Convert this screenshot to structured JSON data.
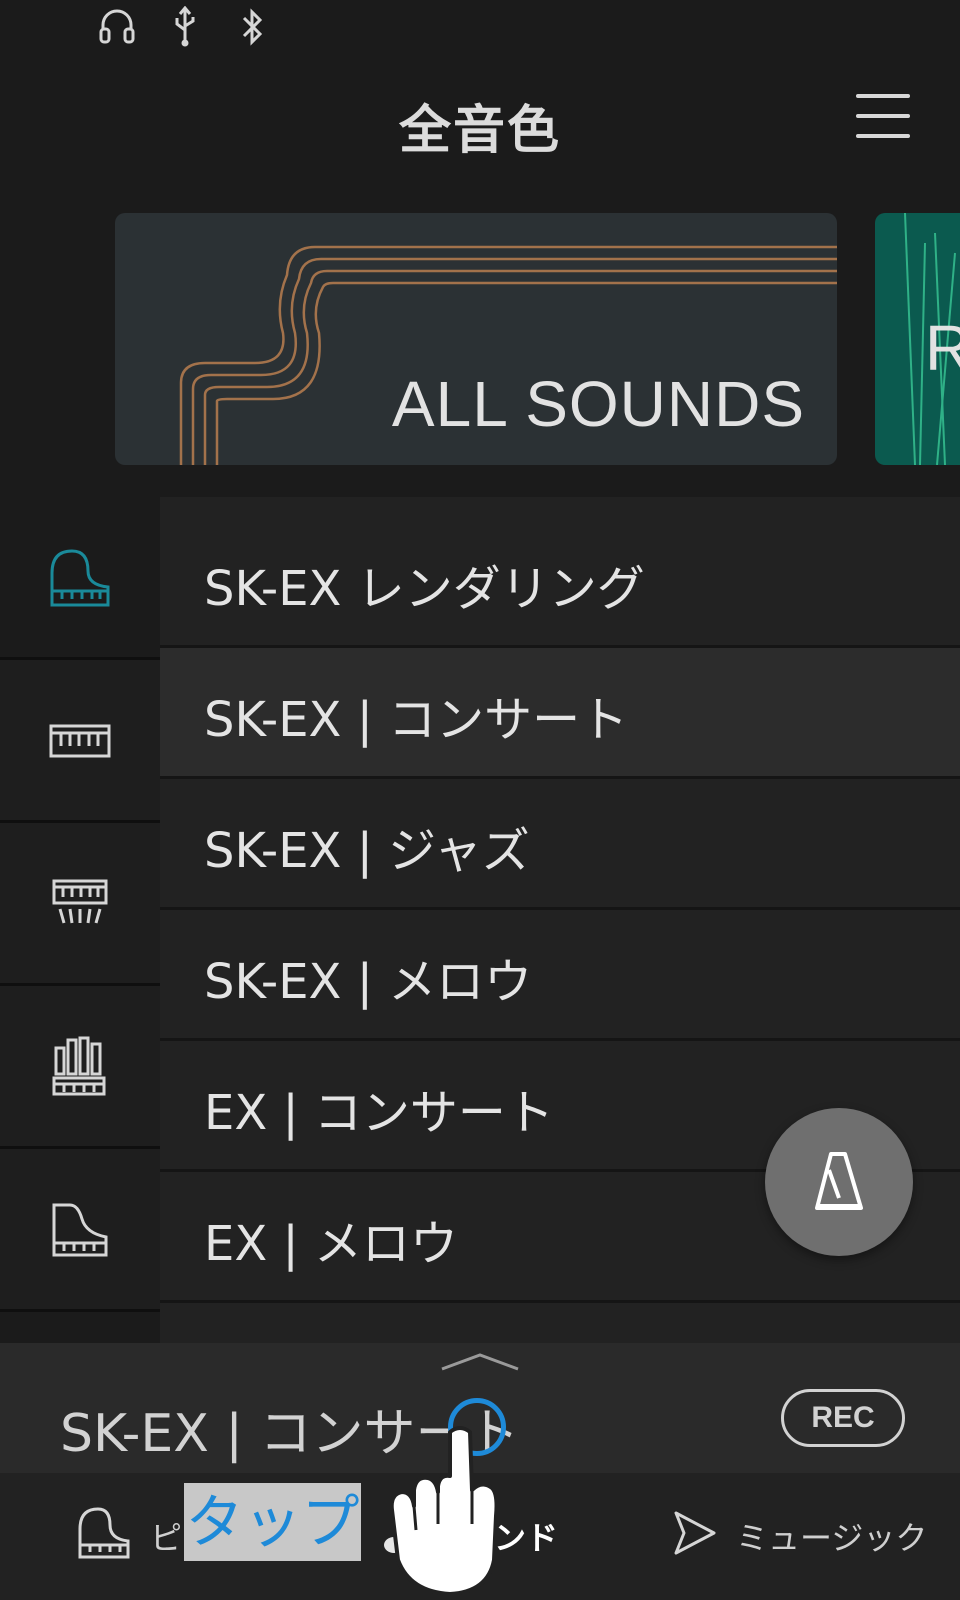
{
  "status_bar": {
    "icons": [
      "headphones-icon",
      "usb-icon",
      "bluetooth-icon"
    ]
  },
  "header": {
    "title": "全音色",
    "menu_icon": "hamburger-icon"
  },
  "banners": [
    {
      "label": "ALL SOUNDS"
    },
    {
      "label": "R"
    }
  ],
  "categories": [
    {
      "icon": "grand-piano-icon",
      "active": true
    },
    {
      "icon": "keyboard-icon",
      "active": false
    },
    {
      "icon": "harpsichord-icon",
      "active": false
    },
    {
      "icon": "organ-icon",
      "active": false
    },
    {
      "icon": "upright-piano-icon",
      "active": false
    }
  ],
  "sound_list": {
    "items": [
      "SK-EX レンダリング",
      "SK-EX | コンサート",
      "SK-EX | ジャズ",
      "SK-EX | メロウ",
      "EX | コンサート",
      "EX | メロウ"
    ],
    "selected_index": 1
  },
  "metronome_button": {
    "icon": "metronome-icon"
  },
  "now_playing": {
    "title": "SK-EX | コンサート",
    "rec_label": "REC",
    "expand_icon": "chevron-up-icon"
  },
  "bottom_nav": {
    "items": [
      {
        "label": "ピアノ",
        "icon": "piano-icon"
      },
      {
        "label": "サウンド",
        "icon": "sound-icon"
      },
      {
        "label": "ミュージック",
        "icon": "play-icon"
      }
    ]
  },
  "annotation": {
    "tap_label": "タップ",
    "hand_icon": "pointing-hand-icon"
  },
  "colors": {
    "accent": "#1e8ad8",
    "active_icon": "#1a8a9a",
    "background": "#1b1b1b"
  }
}
